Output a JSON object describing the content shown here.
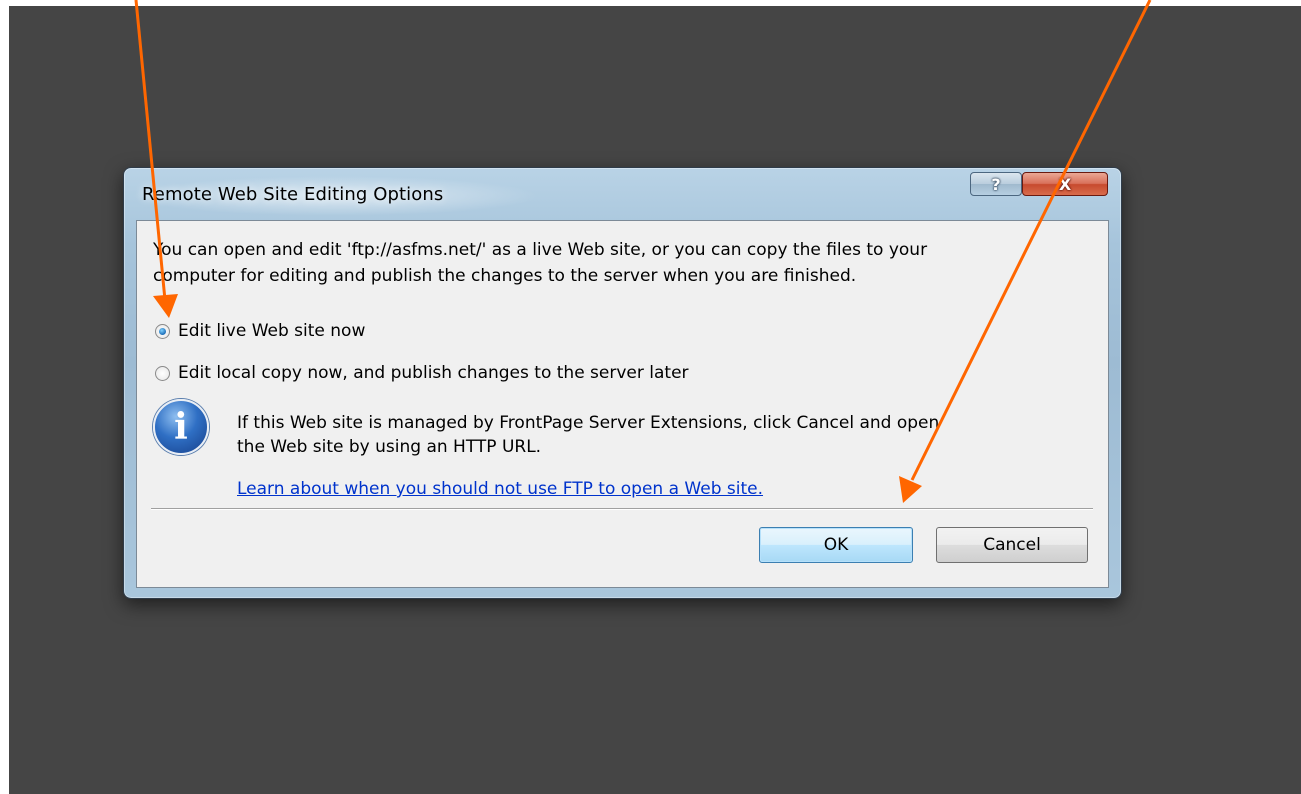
{
  "dialog": {
    "title": "Remote Web Site Editing Options",
    "help_label": "?",
    "close_label": "X",
    "message_line1": "You can open and edit 'ftp://asfms.net/' as a live Web site, or you can copy the files to your",
    "message_line2": "computer for editing and publish the changes to the server when you are finished.",
    "options": [
      {
        "label": "Edit live Web site now",
        "selected": true
      },
      {
        "label": "Edit local copy now, and publish changes to the server later",
        "selected": false
      }
    ],
    "info_icon_glyph": "i",
    "info_line1": "If this Web site is managed by FrontPage Server Extensions, click Cancel and open",
    "info_line2": "the Web site by using an HTTP URL.",
    "learn_link": "Learn about when you should not use FTP to open a Web site.",
    "ok_label": "OK",
    "cancel_label": "Cancel"
  },
  "colors": {
    "backdrop": "#454545",
    "annotation_arrow": "#ff6600",
    "link": "#0033cc"
  }
}
